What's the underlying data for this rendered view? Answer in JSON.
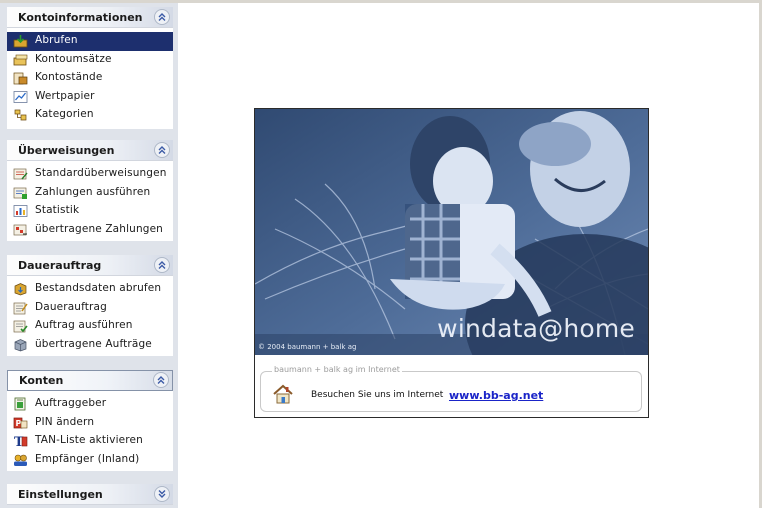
{
  "sidebar": {
    "groups": [
      {
        "title": "Kontoinformationen",
        "expanded": true,
        "toggle_icon": "chevron-double-up-icon",
        "items": [
          {
            "label": "Abrufen",
            "icon": "download-icon",
            "selected": true
          },
          {
            "label": "Kontoumsätze",
            "icon": "transactions-icon"
          },
          {
            "label": "Kontostände",
            "icon": "balances-icon"
          },
          {
            "label": "Wertpapier",
            "icon": "securities-chart-icon"
          },
          {
            "label": "Kategorien",
            "icon": "categories-icon"
          }
        ]
      },
      {
        "title": "Überweisungen",
        "expanded": true,
        "toggle_icon": "chevron-double-up-icon",
        "items": [
          {
            "label": "Standardüberweisungen",
            "icon": "transfer-form-icon"
          },
          {
            "label": "Zahlungen ausführen",
            "icon": "execute-payments-icon"
          },
          {
            "label": "Statistik",
            "icon": "statistics-icon"
          },
          {
            "label": "übertragene Zahlungen",
            "icon": "transferred-payments-icon"
          }
        ]
      },
      {
        "title": "Dauerauftrag",
        "expanded": true,
        "toggle_icon": "chevron-double-up-icon",
        "items": [
          {
            "label": "Bestandsdaten abrufen",
            "icon": "fetch-data-icon"
          },
          {
            "label": "Dauerauftrag",
            "icon": "standing-order-icon"
          },
          {
            "label": "Auftrag ausführen",
            "icon": "execute-order-icon"
          },
          {
            "label": "übertragene Aufträge",
            "icon": "transferred-orders-icon"
          }
        ]
      },
      {
        "title": "Konten",
        "expanded": true,
        "toggle_icon": "chevron-double-up-icon",
        "items": [
          {
            "label": "Auftraggeber",
            "icon": "ordering-party-icon"
          },
          {
            "label": "PIN ändern",
            "icon": "pin-icon"
          },
          {
            "label": "TAN-Liste aktivieren",
            "icon": "tan-list-icon"
          },
          {
            "label": "Empfänger (Inland)",
            "icon": "recipients-icon"
          }
        ]
      },
      {
        "title": "Einstellungen",
        "expanded": false,
        "toggle_icon": "chevron-double-down-icon",
        "items": []
      }
    ]
  },
  "splash": {
    "copyright": "© 2004 baumann + balk ag",
    "brand": "windata@home",
    "internet_legend": "baumann + balk ag im Internet",
    "visit_text": "Besuchen Sie uns im Internet",
    "link": "www.bb-ag.net"
  },
  "colors": {
    "selection": "#1d2f6e",
    "link": "#1a24c8",
    "photo_tint": "#425e86",
    "sidebar_bg": "#dfe3ea"
  }
}
